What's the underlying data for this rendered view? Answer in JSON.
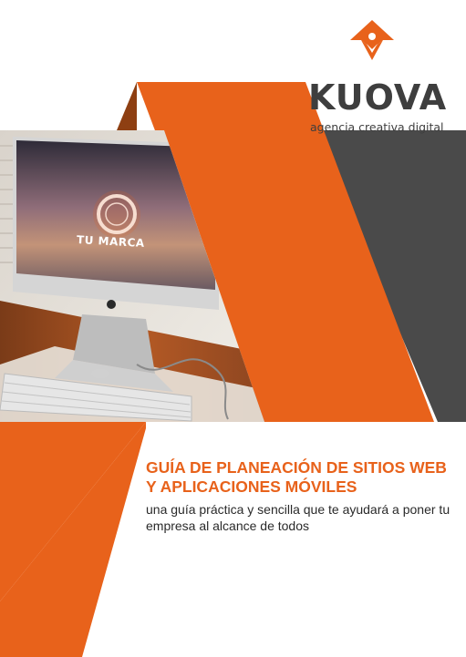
{
  "brand": {
    "name": "KUOVA",
    "tagline": "agencia creativa digital",
    "icon": "kuova-logo-icon"
  },
  "photo": {
    "screen_text": "TU MARCA"
  },
  "cover": {
    "title": "GUÍA DE PLANEACIÓN DE SITIOS WEB Y APLICACIONES MÓVILES",
    "subtitle": "una guía práctica y sencilla que te ayudará a poner tu empresa al alcance de todos"
  },
  "colors": {
    "accent_orange": "#e8621b",
    "dark_gray": "#4a4a4a",
    "text_dark": "#2a2a2a"
  }
}
